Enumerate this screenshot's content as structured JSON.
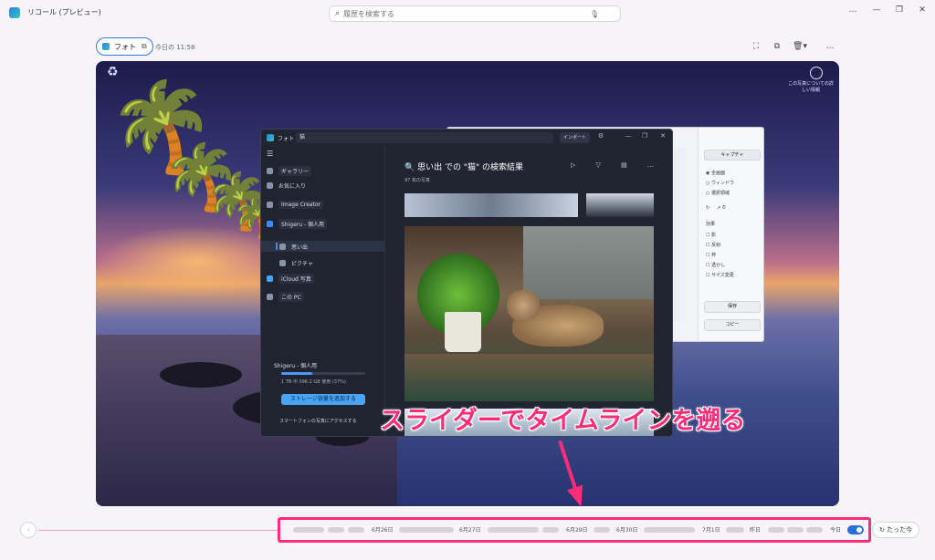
{
  "window": {
    "title": "リコール (プレビュー)",
    "search_placeholder": "履歴を検索する",
    "controls": [
      "…",
      "—",
      "❐",
      "✕"
    ]
  },
  "snapshot": {
    "app_chip_label": "フォト",
    "timestamp": "今日の 11:58",
    "actions": [
      "copy-snapshot-icon",
      "copy-icon",
      "delete-icon",
      "more-icon"
    ]
  },
  "desktop": {
    "context_button_text": "この写真についての詳しい情報"
  },
  "photos_app": {
    "app_label": "フォト",
    "search_query": "猫",
    "import_label": "インポート",
    "nav": [
      {
        "label": "ギャラリー"
      },
      {
        "label": "お気に入り"
      },
      {
        "label": "Image Creator"
      },
      {
        "label": "Shigeru - 個人用"
      },
      {
        "label": "思い出"
      },
      {
        "label": "ピクチャ"
      },
      {
        "label": "iCloud 写真"
      },
      {
        "label": "この PC"
      }
    ],
    "storage": {
      "title": "Shigeru - 個人用",
      "usage_text": "1 TB 中 396.2 GB 使用 (37%)",
      "usage_fraction": 0.37,
      "add_button": "ストレージ容量を追加する",
      "phone_button": "スマートフォンの写真にアクセスする"
    },
    "results_title": "思い出 での \"猫\" の検索結果",
    "results_count": "97 枚の写真"
  },
  "snipping_tool": {
    "capture_label": "キャプチャ",
    "modes": [
      "全画面",
      "ウィンドウ",
      "選択領域"
    ],
    "effects_label": "効果",
    "effects": [
      "影",
      "反射",
      "枠",
      "透かし",
      "サイズ変更"
    ],
    "save_label": "保存",
    "copy_label": "コピー"
  },
  "annotation": {
    "caption": "スライダーでタイムラインを遡る",
    "accent_color": "#ff2c79"
  },
  "timeline": {
    "labels": [
      "6月26日",
      "6月27日",
      "6月29日",
      "6月30日",
      "7月1日",
      "昨日",
      "今日"
    ],
    "now_button": "たった今"
  }
}
